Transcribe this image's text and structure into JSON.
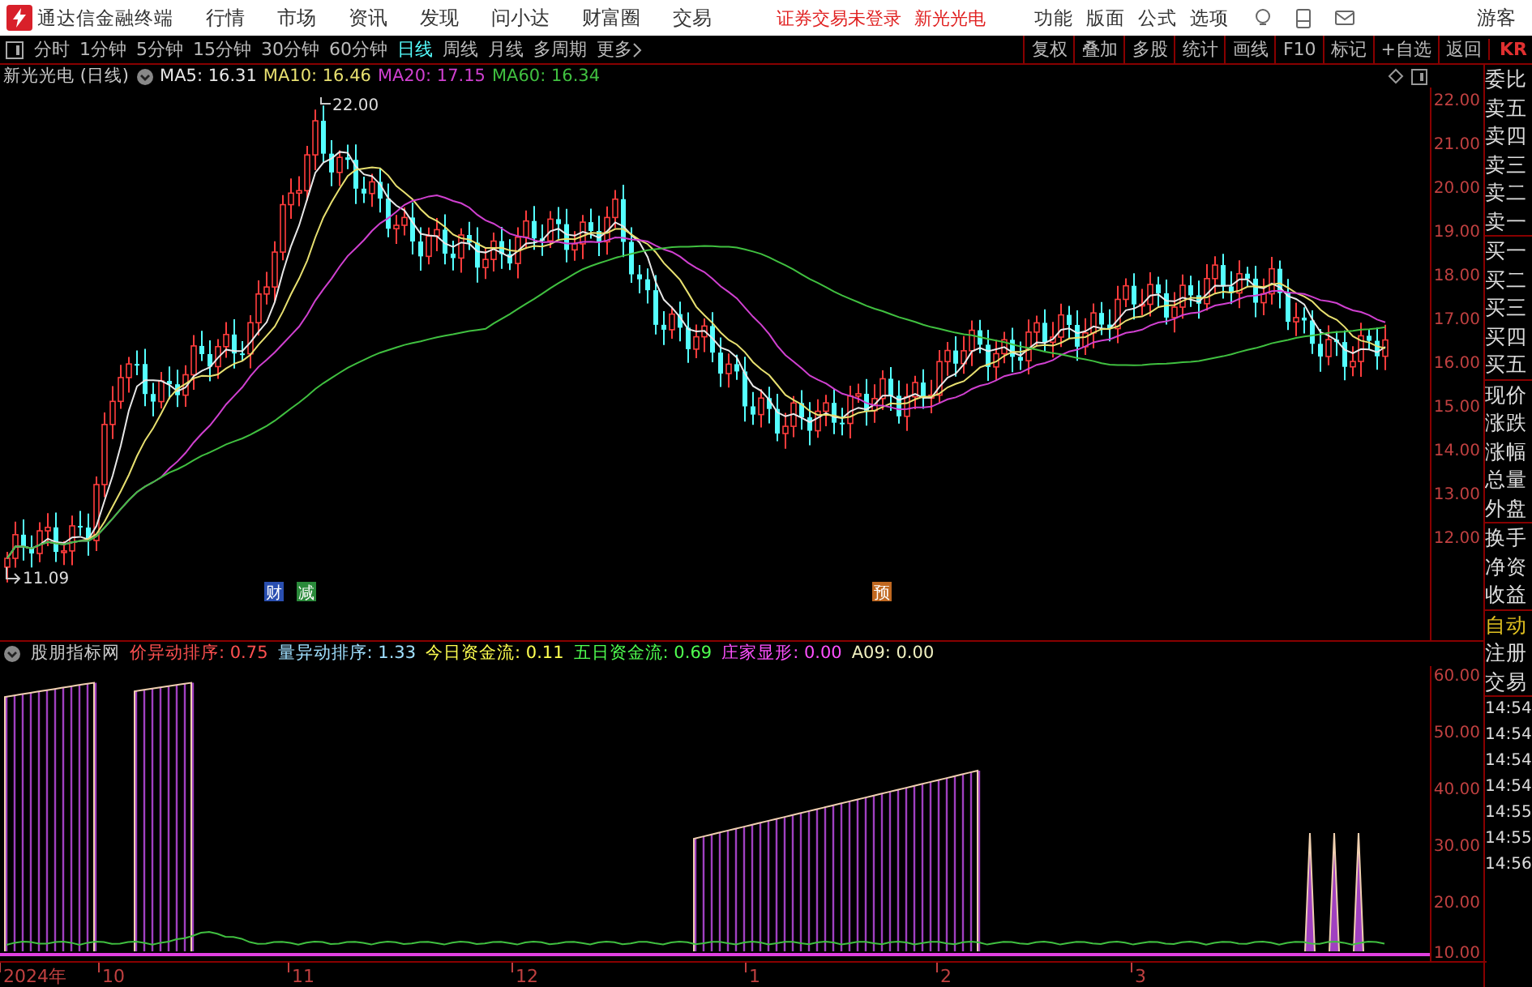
{
  "menubar": {
    "app_title": "通达信金融终端",
    "menus": [
      "行情",
      "市场",
      "资讯",
      "发现",
      "问小达",
      "财富圈",
      "交易"
    ],
    "notice": "证券交易未登录",
    "stock_link": "新光光电",
    "right_menus": [
      "功能",
      "版面",
      "公式",
      "选项"
    ],
    "user": "游客"
  },
  "period_tabs": [
    {
      "label": "分时",
      "selected": false
    },
    {
      "label": "1分钟",
      "selected": false
    },
    {
      "label": "5分钟",
      "selected": false
    },
    {
      "label": "15分钟",
      "selected": false
    },
    {
      "label": "30分钟",
      "selected": false
    },
    {
      "label": "60分钟",
      "selected": false
    },
    {
      "label": "日线",
      "selected": true
    },
    {
      "label": "周线",
      "selected": false
    },
    {
      "label": "月线",
      "selected": false
    },
    {
      "label": "多周期",
      "selected": false
    }
  ],
  "more_label": "更多",
  "tool_buttons": [
    "复权",
    "叠加",
    "多股",
    "统计",
    "画线",
    "F10",
    "标记",
    "+自选",
    "返回"
  ],
  "corner_label": "KR",
  "price_chart": {
    "stock": "新光光电 (日线)",
    "ma": [
      {
        "label": "MA5: 16.31",
        "color": "#e8e8e8"
      },
      {
        "label": "MA10: 16.46",
        "color": "#e8e070"
      },
      {
        "label": "MA20: 17.15",
        "color": "#d040d0"
      },
      {
        "label": "MA60: 16.34",
        "color": "#40c040"
      }
    ],
    "high_label": "22.00",
    "low_label": "11.09",
    "axis": [
      "22.00",
      "21.00",
      "20.00",
      "19.00",
      "18.00",
      "17.00",
      "16.00",
      "15.00",
      "14.00",
      "13.00",
      "12.00"
    ],
    "event_marks": [
      {
        "label": "财",
        "color": "#2a4fb0"
      },
      {
        "label": "减",
        "color": "#2a8a3a"
      },
      {
        "label": "预",
        "color": "#c06820"
      }
    ]
  },
  "indicator": {
    "name": "股朋指标网",
    "values": [
      {
        "label": "价异动排序: 0.75",
        "color": "#ff5050"
      },
      {
        "label": "量异动排序: 1.33",
        "color": "#a0e0ff"
      },
      {
        "label": "今日资金流: 0.11",
        "color": "#ffff50"
      },
      {
        "label": "五日资金流: 0.69",
        "color": "#50ff50"
      },
      {
        "label": "庄家显形: 0.00",
        "color": "#ff50ff"
      },
      {
        "label": "A09: 0.00",
        "color": "#f0f0c0"
      }
    ],
    "axis": [
      "60.00",
      "50.00",
      "40.00",
      "30.00",
      "20.00",
      "10.00"
    ]
  },
  "date_axis": [
    "2024年",
    "10",
    "11",
    "12",
    "1",
    "2",
    "3"
  ],
  "quote_panel": {
    "rows": [
      {
        "label": "委比",
        "kind": "label"
      },
      {
        "label": "卖五",
        "kind": "label"
      },
      {
        "label": "卖四",
        "kind": "label"
      },
      {
        "label": "卖三",
        "kind": "label"
      },
      {
        "label": "卖二",
        "kind": "label"
      },
      {
        "label": "卖一",
        "kind": "label"
      },
      {
        "label": "买一",
        "kind": "label"
      },
      {
        "label": "买二",
        "kind": "label"
      },
      {
        "label": "买三",
        "kind": "label"
      },
      {
        "label": "买四",
        "kind": "label"
      },
      {
        "label": "买五",
        "kind": "label"
      },
      {
        "label": "现价",
        "kind": "label"
      },
      {
        "label": "涨跌",
        "kind": "label"
      },
      {
        "label": "涨幅",
        "kind": "label"
      },
      {
        "label": "总量",
        "kind": "label"
      },
      {
        "label": "外盘",
        "kind": "label"
      },
      {
        "label": "换手",
        "kind": "label"
      },
      {
        "label": "净资",
        "kind": "label"
      },
      {
        "label": "收益",
        "kind": "label"
      },
      {
        "label": "自动",
        "kind": "highlight"
      },
      {
        "label": "注册",
        "kind": "label"
      },
      {
        "label": "交易",
        "kind": "label"
      }
    ],
    "times": [
      "14:54",
      "14:54",
      "14:54",
      "14:54",
      "14:55",
      "14:55",
      "14:56"
    ]
  }
}
